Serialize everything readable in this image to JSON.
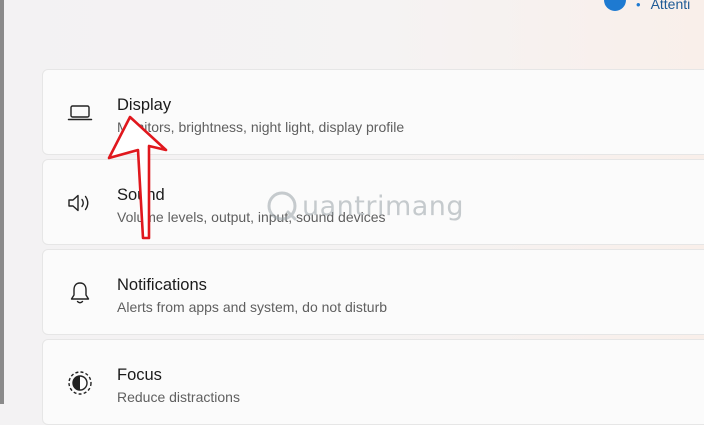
{
  "header": {
    "status_text": "Attenti",
    "bullet": "•"
  },
  "settings": [
    {
      "title": "Display",
      "subtitle": "Monitors, brightness, night light, display profile",
      "icon": "laptop-icon"
    },
    {
      "title": "Sound",
      "subtitle": "Volume levels, output, input, sound devices",
      "icon": "speaker-icon"
    },
    {
      "title": "Notifications",
      "subtitle": "Alerts from apps and system, do not disturb",
      "icon": "bell-icon"
    },
    {
      "title": "Focus",
      "subtitle": "Reduce distractions",
      "icon": "focus-icon"
    }
  ],
  "annotation": {
    "arrow_color": "#e0171d",
    "watermark": "uantrimang"
  },
  "colors": {
    "accent": "#1e7ad1",
    "card_bg": "#fbfbfb",
    "card_border": "#e6e6e6"
  }
}
